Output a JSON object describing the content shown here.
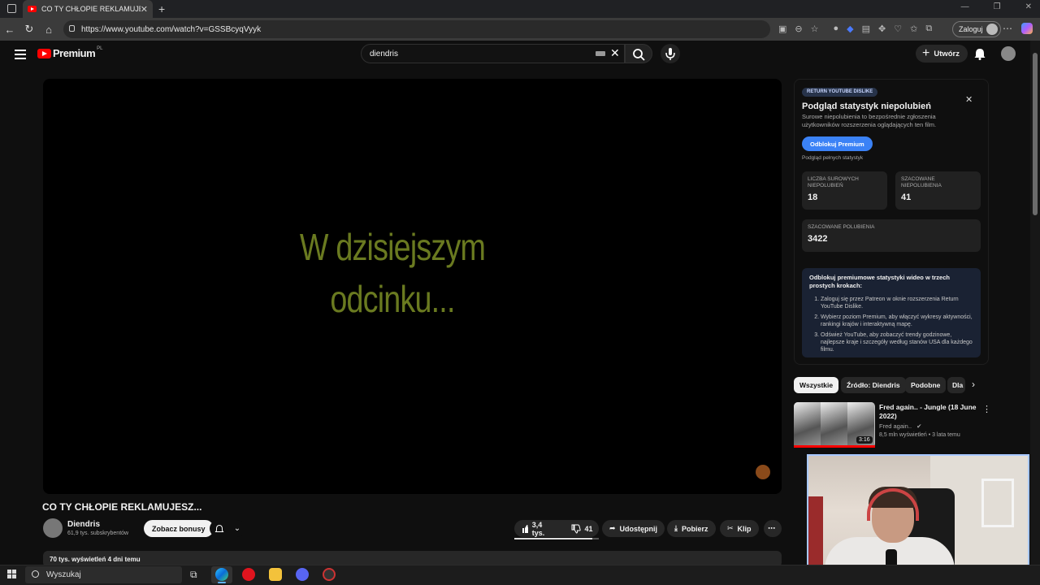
{
  "browser": {
    "tab_title": "CO TY CHŁOPIE REKLAMUJESZ...",
    "url": "https://www.youtube.com/watch?v=GSSBcyqVyyk",
    "login_label": "Zaloguj"
  },
  "header": {
    "logo_text": "Premium",
    "logo_region": "PL",
    "search_value": "diendris",
    "create_label": "Utwórz"
  },
  "video": {
    "overlay_line1": "W dzisiejszym",
    "overlay_line2": "odcinku...",
    "title": "CO TY CHŁOPIE REKLAMUJESZ...",
    "channel_name": "Diendris",
    "channel_subs": "61,9 tys. subskrybentów",
    "bonus_label": "Zobacz bonusy",
    "likes": "3,4 tys.",
    "dislikes": "41",
    "share_label": "Udostępnij",
    "download_label": "Pobierz",
    "clip_label": "Klip",
    "description_peek": "70 tys. wyświetleń  4 dni temu"
  },
  "ryd": {
    "badge": "RETURN YOUTUBE DISLIKE",
    "title": "Podgląd statystyk niepolubień",
    "description": "Surowe niepolubienia to bezpośrednie zgłoszenia użytkowników rozszerzenia oglądających ten film.",
    "unlock_label": "Odblokuj Premium",
    "preview_note": "Podgląd pełnych statystyk",
    "stats": [
      {
        "label": "Liczba surowych niepolubień",
        "value": "18"
      },
      {
        "label": "Szacowane niepolubienia",
        "value": "41"
      },
      {
        "label": "Szacowane polubienia",
        "value": "3422"
      }
    ],
    "promo_heading": "Odblokuj premiumowe statystyki wideo w trzech prostych krokach:",
    "promo_steps": [
      "Zaloguj się przez Patreon w oknie rozszerzenia Return YouTube Dislike.",
      "Wybierz poziom Premium, aby włączyć wykresy aktywności, rankingi krajów i interaktywną mapę.",
      "Odśwież YouTube, aby zobaczyć trendy godzinowe, najlepsze kraje i szczegóły według stanów USA dla każdego filmu."
    ]
  },
  "chips": [
    "Wszystkie",
    "Źródło: Diendris",
    "Podobne",
    "Dla"
  ],
  "recommended": {
    "title": "Fred again.. - Jungle (18 June 2022)",
    "channel": "Fred again..",
    "meta": "8,5 mln wyświetleń • 3 lata temu",
    "duration": "3:16",
    "watched_fraction": 1.0
  },
  "taskbar": {
    "search_placeholder": "Wyszukaj"
  },
  "colors": {
    "yt_red": "#ff0000",
    "ryd_button": "#3b82f6",
    "overlay_text": "#6a7a20"
  }
}
